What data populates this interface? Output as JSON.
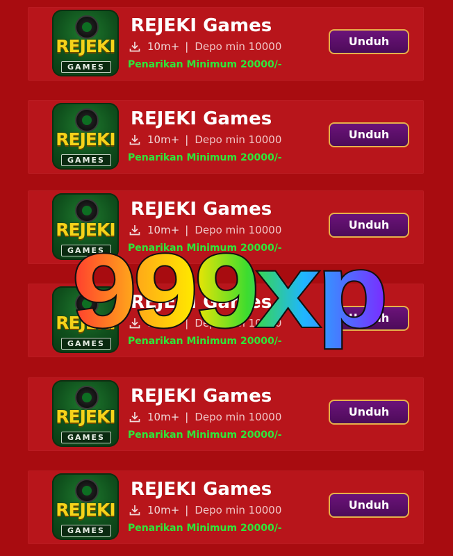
{
  "apps": [
    {
      "title": "REJEKI Games",
      "downloads": "10m+",
      "separator": "|",
      "deposit": "Depo min 10000",
      "withdrawal": "Penarikan Minimum 20000/-",
      "button": "Unduh",
      "icon_brand": "REJEKI",
      "icon_sub": "GAMES"
    },
    {
      "title": "REJEKI Games",
      "downloads": "10m+",
      "separator": "|",
      "deposit": "Depo min 10000",
      "withdrawal": "Penarikan Minimum 20000/-",
      "button": "Unduh",
      "icon_brand": "REJEKI",
      "icon_sub": "GAMES"
    },
    {
      "title": "REJEKI Games",
      "downloads": "10m+",
      "separator": "|",
      "deposit": "Depo min 10000",
      "withdrawal": "Penarikan Minimum 20000/-",
      "button": "Unduh",
      "icon_brand": "REJEKI",
      "icon_sub": "GAMES"
    },
    {
      "title": "REJEKI Games",
      "downloads": "10m+",
      "separator": "|",
      "deposit": "Depo min 10000",
      "withdrawal": "Penarikan Minimum 20000/-",
      "button": "Unduh",
      "icon_brand": "REJEKI",
      "icon_sub": "GAMES"
    },
    {
      "title": "REJEKI Games",
      "downloads": "10m+",
      "separator": "|",
      "deposit": "Depo min 10000",
      "withdrawal": "Penarikan Minimum 20000/-",
      "button": "Unduh",
      "icon_brand": "REJEKI",
      "icon_sub": "GAMES"
    },
    {
      "title": "REJEKI Games",
      "downloads": "10m+",
      "separator": "|",
      "deposit": "Depo min 10000",
      "withdrawal": "Penarikan Minimum 20000/-",
      "button": "Unduh",
      "icon_brand": "REJEKI",
      "icon_sub": "GAMES"
    }
  ],
  "watermark": {
    "text": "999xp",
    "colors": [
      "#ff3b2f",
      "#ff9f1c",
      "#ffe600",
      "#3ddc2f",
      "#1fb6ff",
      "#7a2cff"
    ]
  },
  "icons": {
    "download": "download-icon"
  },
  "theme": {
    "background": "#a80c10",
    "card": "#b8151b",
    "title": "#ffffff",
    "withdrawal": "#2ee83a",
    "button": "#5a0f68",
    "button_border": "#e6b04a"
  }
}
